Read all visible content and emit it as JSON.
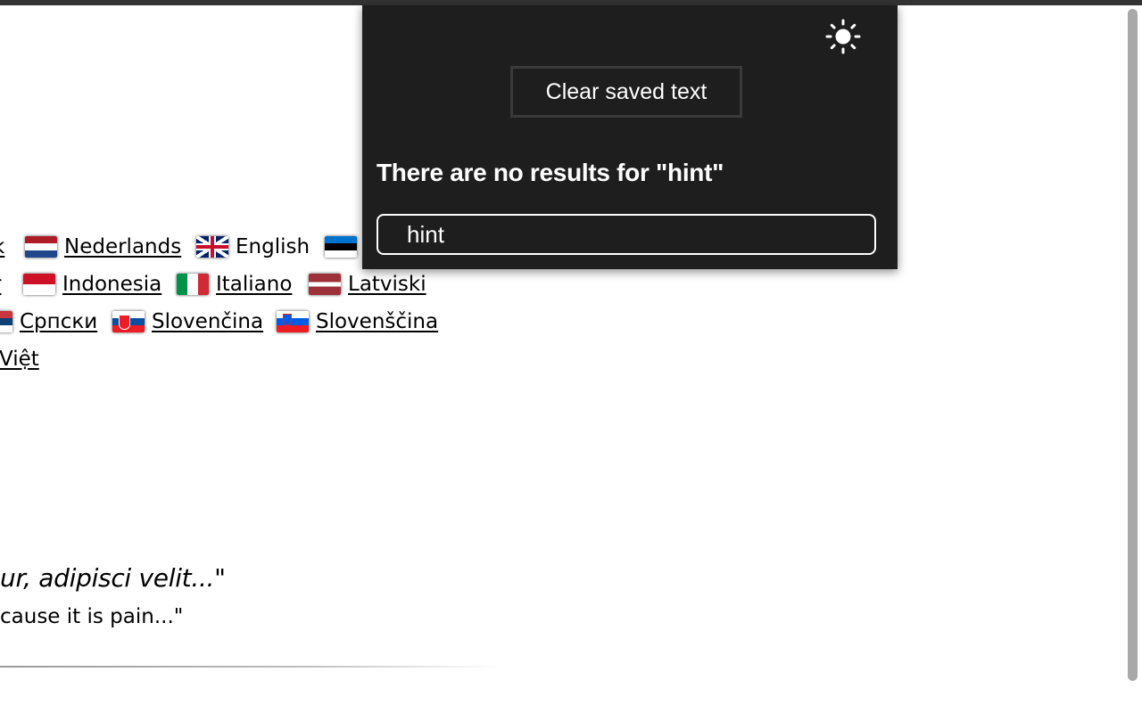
{
  "languages": {
    "row1": [
      "k",
      "Nederlands",
      "English"
    ],
    "row2": [
      "r",
      "Indonesia",
      "Italiano",
      "Latviski"
    ],
    "row3": [
      "Српски",
      "Slovenčina",
      "Slovenščina"
    ],
    "row4": [
      "Việt"
    ]
  },
  "quotes": {
    "latin": "ur, adipisci velit...\"",
    "english": "cause it is pain...\""
  },
  "popup": {
    "theme_icon": "sun-icon",
    "clear_button": "Clear saved text",
    "no_results": "There are no results for \"hint\"",
    "search_value": "hint"
  },
  "colors": {
    "popup_bg": "#1e1e1e",
    "popup_text": "#ffffff",
    "link": "#000000"
  }
}
